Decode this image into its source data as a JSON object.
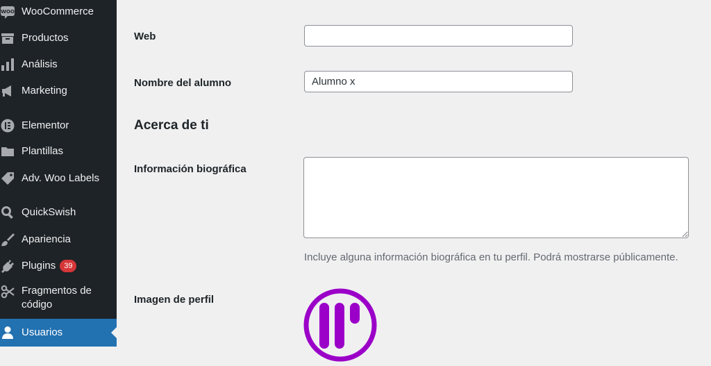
{
  "sidebar": {
    "items": [
      {
        "label": "WooCommerce",
        "icon": "woo-icon"
      },
      {
        "label": "Productos",
        "icon": "box-icon"
      },
      {
        "label": "Análisis",
        "icon": "bar-chart-icon"
      },
      {
        "label": "Marketing",
        "icon": "megaphone-icon"
      },
      {
        "label": "Elementor",
        "icon": "elementor-icon"
      },
      {
        "label": "Plantillas",
        "icon": "folder-icon"
      },
      {
        "label": "Adv. Woo Labels",
        "icon": "tag-icon"
      },
      {
        "label": "QuickSwish",
        "icon": "search-icon"
      },
      {
        "label": "Apariencia",
        "icon": "brush-icon"
      },
      {
        "label": "Plugins",
        "icon": "plug-icon",
        "badge": "39"
      },
      {
        "label": "Fragmentos de código",
        "icon": "scissors-icon"
      },
      {
        "label": "Usuarios",
        "icon": "user-icon",
        "active": true
      }
    ]
  },
  "form": {
    "web_label": "Web",
    "web_value": "",
    "student_name_label": "Nombre del alumno",
    "student_name_value": "Alumno x",
    "about_title": "Acerca de ti",
    "bio_label": "Información biográfica",
    "bio_value": "",
    "bio_description": "Incluye alguna información biográfica en tu perfil. Podrá mostrarse públicamente.",
    "avatar_label": "Imagen de perfil"
  },
  "colors": {
    "sidebar_bg": "#1d2327",
    "active_bg": "#2271b1",
    "badge_bg": "#d63638",
    "avatar_purple": "#9b00c8"
  }
}
